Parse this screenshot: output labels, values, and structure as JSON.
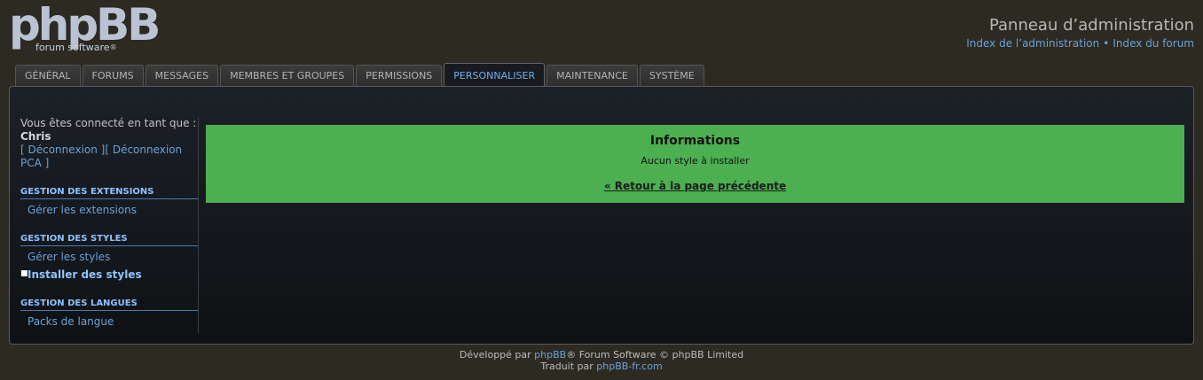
{
  "logo": {
    "text": "phpBB",
    "subtitle": "forum software",
    "registered": "®"
  },
  "header": {
    "title": "Panneau d’administration",
    "link_admin_index": "Index de l’administration",
    "separator": "•",
    "link_forum_index": "Index du forum"
  },
  "tabs": [
    {
      "label": "GÉNÉRAL"
    },
    {
      "label": "FORUMS"
    },
    {
      "label": "MESSAGES"
    },
    {
      "label": "MEMBRES ET GROUPES"
    },
    {
      "label": "PERMISSIONS"
    },
    {
      "label": "PERSONNALISER",
      "active": true
    },
    {
      "label": "MAINTENANCE"
    },
    {
      "label": "SYSTÈME"
    }
  ],
  "sidebar": {
    "logged_in_label": "Vous êtes connecté en tant que :",
    "username": "Chris",
    "logout_link": "[ Déconnexion ]",
    "logout_acp_link": "[ Déconnexion PCA ]",
    "sections": [
      {
        "heading": "GESTION DES EXTENSIONS",
        "items": [
          {
            "label": "Gérer les extensions"
          }
        ]
      },
      {
        "heading": "GESTION DES STYLES",
        "items": [
          {
            "label": "Gérer les styles"
          },
          {
            "label": "Installer des styles",
            "active": true
          }
        ]
      },
      {
        "heading": "GESTION DES LANGUES",
        "items": [
          {
            "label": "Packs de langue"
          }
        ]
      }
    ]
  },
  "info": {
    "title": "Informations",
    "message": "Aucun style à installer",
    "back_link": "« Retour à la page précédente"
  },
  "footer": {
    "line1_prefix": "Développé par ",
    "line1_link": "phpBB",
    "line1_suffix": "® Forum Software © phpBB Limited",
    "line2_prefix": "Traduit par ",
    "line2_link": "phpBB-fr.com"
  },
  "colors": {
    "background": "#2d2a22",
    "accent_link": "#6aa2d9",
    "info_green": "#4caf50",
    "active_tab_text": "#6fb0ef"
  }
}
